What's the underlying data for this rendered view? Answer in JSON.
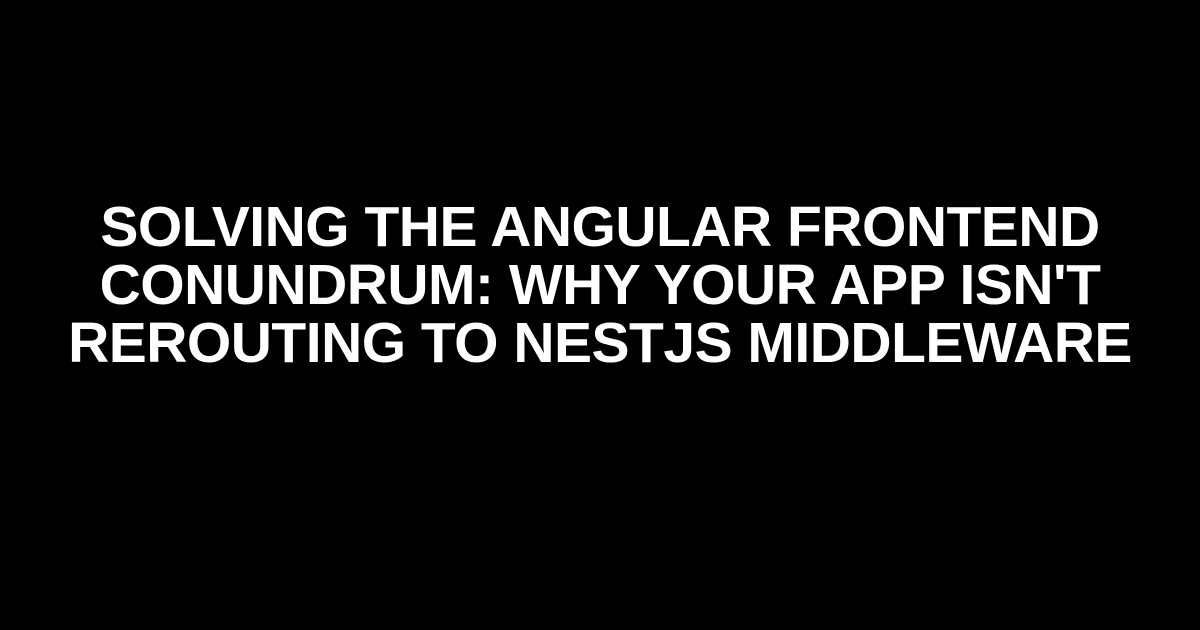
{
  "title": "SOLVING THE ANGULAR FRONTEND CONUNDRUM: WHY YOUR APP ISN'T REROUTING TO NESTJS MIDDLEWARE"
}
